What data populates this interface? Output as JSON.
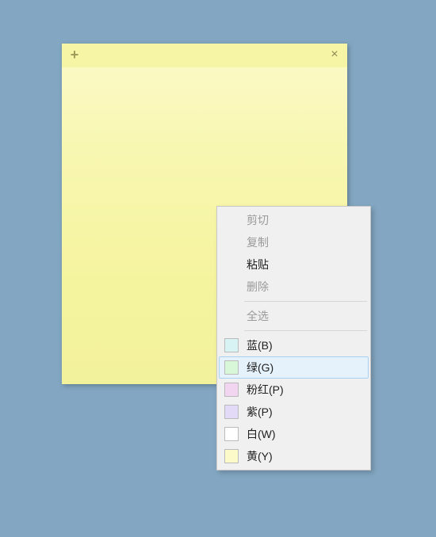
{
  "desktop": {
    "bg_color": "#83a7c2"
  },
  "note": {
    "add_glyph": "+",
    "close_glyph": "×",
    "body_text": ""
  },
  "context_menu": {
    "edit_items": [
      {
        "label": "剪切",
        "enabled": false
      },
      {
        "label": "复制",
        "enabled": false
      },
      {
        "label": "粘贴",
        "enabled": true
      },
      {
        "label": "删除",
        "enabled": false
      }
    ],
    "select_all": {
      "label": "全选",
      "enabled": false
    },
    "color_items": [
      {
        "label": "蓝(B)",
        "swatch": "#d7f3f3",
        "highlight": false
      },
      {
        "label": "绿(G)",
        "swatch": "#d8f6d8",
        "highlight": true
      },
      {
        "label": "粉红(P)",
        "swatch": "#f2d6f1",
        "highlight": false
      },
      {
        "label": "紫(P)",
        "swatch": "#e3daf8",
        "highlight": false
      },
      {
        "label": "白(W)",
        "swatch": "#ffffff",
        "highlight": false
      },
      {
        "label": "黄(Y)",
        "swatch": "#fbfac8",
        "highlight": false
      }
    ]
  }
}
